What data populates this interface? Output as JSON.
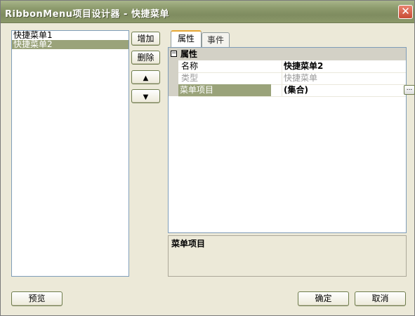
{
  "window": {
    "title": "RibbonMenu项目设计器 - 快捷菜单"
  },
  "menu_list": {
    "items": [
      "快捷菜单1",
      "快捷菜单2"
    ],
    "selected_index": 1
  },
  "buttons": {
    "add": "增加",
    "delete": "删除",
    "move_up": "🠅",
    "move_down": "🠇",
    "preview": "预览",
    "ok": "确定",
    "cancel": "取消"
  },
  "tabs": [
    "属性",
    "事件"
  ],
  "property_grid": {
    "category": "属性",
    "collapse_glyph": "−",
    "rows": [
      {
        "name": "名称",
        "value": "快捷菜单2"
      },
      {
        "name": "类型",
        "value": "快捷菜单"
      },
      {
        "name": "菜单项目",
        "value": "(集合)"
      }
    ],
    "ellipsis": "..."
  },
  "description": {
    "title": "菜单项目"
  },
  "colors": {
    "title_bar": "#8c9a6c",
    "selection": "#9aa37a",
    "close": "#c94b34"
  }
}
